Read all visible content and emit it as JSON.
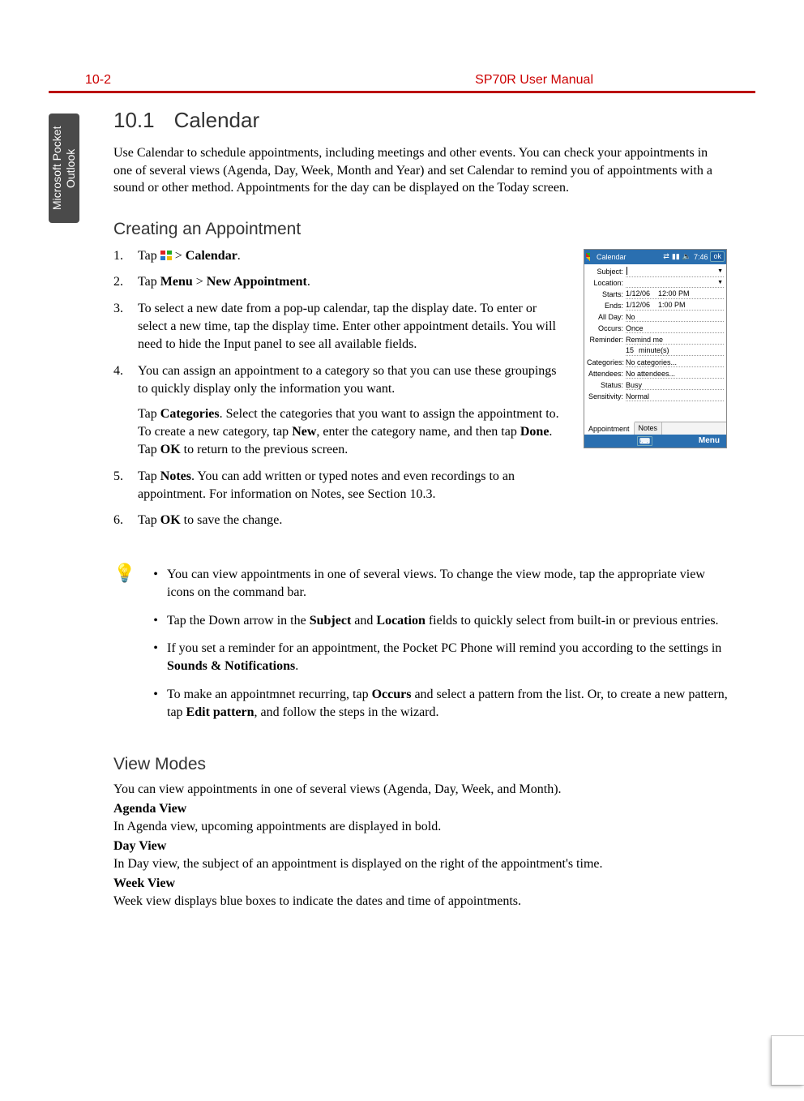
{
  "header": {
    "page_number": "10-2",
    "manual_title": "SP70R User Manual"
  },
  "side_tab": "Microsoft Pocket Outlook",
  "section": {
    "number": "10.1",
    "title": "Calendar",
    "intro": "Use Calendar to schedule appointments, including meetings and other events. You can check your appointments in one of several views (Agenda, Day, Week, Month and Year) and set Calendar to remind you of appointments with a sound or other method. Appointments for the day can be displayed on the Today screen."
  },
  "creating": {
    "heading": "Creating an Appointment",
    "steps": {
      "s1_a": "Tap ",
      "s1_b": " > ",
      "s1_c": "Calendar",
      "s1_d": ".",
      "s2_a": "Tap ",
      "s2_b": "Menu",
      "s2_c": " > ",
      "s2_d": "New Appointment",
      "s2_e": ".",
      "s3": "To select a new date from a pop-up calendar, tap the display date. To enter or select a new time, tap the display time. Enter other appointment details. You will need to hide the Input panel to see all available fields.",
      "s4": "You can assign an appointment to a category so that you can use these groupings to quickly display only the information you want.",
      "s4b_a": "Tap ",
      "s4b_b": "Categories",
      "s4b_c": ". Select the categories that you want to assign the appointment to. To create a new category, tap ",
      "s4b_d": "New",
      "s4b_e": ", enter the category name, and then tap ",
      "s4b_f": "Done",
      "s4b_g": ".",
      "s4c_a": "Tap ",
      "s4c_b": "OK",
      "s4c_c": " to return to the previous screen.",
      "s5_a": "Tap ",
      "s5_b": "Notes",
      "s5_c": ". You can add written or typed notes and even recordings to an appointment. For information on Notes, see Section 10.3.",
      "s6_a": "Tap ",
      "s6_b": "OK",
      "s6_c": " to save the change."
    }
  },
  "tips": {
    "t1": "You can view appointments in one of several views. To change the view mode, tap the appropriate view icons on the command bar.",
    "t2_a": "Tap the Down arrow in the ",
    "t2_b": "Subject",
    "t2_c": " and ",
    "t2_d": "Location",
    "t2_e": " fields to quickly select from built-in or previous entries.",
    "t3_a": "If you set a reminder for an appointment, the Pocket PC Phone will remind you according to the settings in ",
    "t3_b": "Sounds & Notifications",
    "t3_c": ".",
    "t4_a": "To make an appointmnet recurring, tap ",
    "t4_b": "Occurs",
    "t4_c": " and select a pattern from the list. Or, to create a new pattern, tap ",
    "t4_d": "Edit pattern",
    "t4_e": ", and follow the steps in the wizard."
  },
  "view_modes": {
    "heading": "View Modes",
    "intro": "You can view appointments in one of several views (Agenda, Day, Week, and Month).",
    "agenda_h": "Agenda View",
    "agenda_p": "In Agenda view, upcoming appointments are displayed in bold.",
    "day_h": "Day View",
    "day_p": "In Day view, the subject of an appointment is displayed on the right of the appointment's time.",
    "week_h": "Week View",
    "week_p": "Week view displays blue boxes to indicate the dates and time of appointments."
  },
  "screenshot": {
    "title": "Calendar",
    "time": "7:46",
    "ok": "ok",
    "fields": {
      "subject_lbl": "Subject:",
      "subject_val": "",
      "location_lbl": "Location:",
      "location_val": "",
      "starts_lbl": "Starts:",
      "starts_date": "1/12/06",
      "starts_time": "12:00 PM",
      "ends_lbl": "Ends:",
      "ends_date": "1/12/06",
      "ends_time": "1:00 PM",
      "allday_lbl": "All Day:",
      "allday_val": "No",
      "occurs_lbl": "Occurs:",
      "occurs_val": "Once",
      "reminder_lbl": "Reminder:",
      "reminder_val": "Remind me",
      "reminder_num": "15",
      "reminder_unit": "minute(s)",
      "categories_lbl": "Categories:",
      "categories_val": "No categories...",
      "attendees_lbl": "Attendees:",
      "attendees_val": "No attendees...",
      "status_lbl": "Status:",
      "status_val": "Busy",
      "sensitivity_lbl": "Sensitivity:",
      "sensitivity_val": "Normal"
    },
    "tabs": {
      "appointment": "Appointment",
      "notes": "Notes"
    },
    "bottom": {
      "keyboard": "⌨",
      "menu": "Menu"
    }
  }
}
